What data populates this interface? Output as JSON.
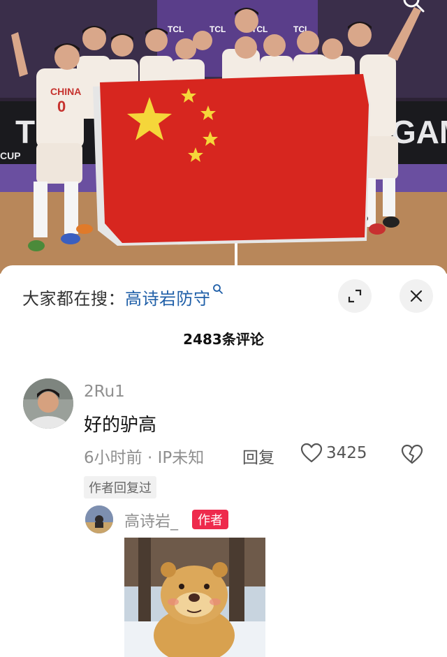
{
  "hot_search": {
    "prefix": "大家都在搜：",
    "term": "高诗岩防守"
  },
  "comments_count": "2483条评论",
  "comment": {
    "username": "2Ru1",
    "text": "好的驴高",
    "time_ip": "6小时前 · IP未知",
    "reply_label": "回复",
    "like_count": "3425",
    "author_replied_badge": "作者回复过"
  },
  "reply": {
    "username": "高诗岩_",
    "author_badge": "作者"
  },
  "photo": {
    "jersey_text": "CHINA",
    "jersey_number": "0",
    "board_text": "GAM",
    "board_text_left": "T",
    "sponsor_text": "TCL",
    "cup_text": "CUP"
  },
  "icons": {
    "search": "search-icon",
    "expand": "expand-icon",
    "close": "close-icon",
    "like": "heart-icon",
    "dislike": "broken-heart-icon"
  },
  "colors": {
    "link_blue": "#1f5fa8",
    "author_red": "#ee2a4c",
    "flag_red": "#d7261f",
    "flag_star": "#f5d63a"
  }
}
